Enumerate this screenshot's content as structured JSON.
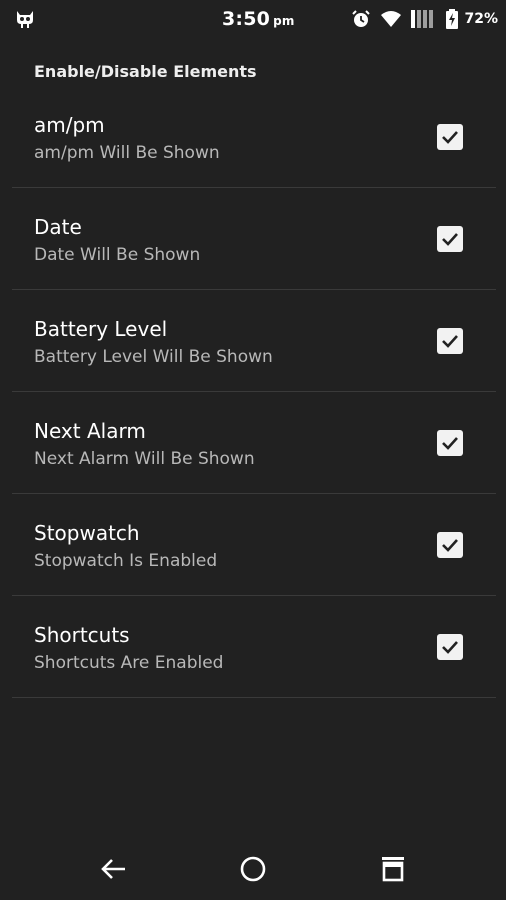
{
  "status_bar": {
    "time": "3:50",
    "ampm": "pm",
    "battery_percent": "72%",
    "icons": [
      "app-notification-icon",
      "alarm-icon",
      "wifi-icon",
      "signal-icon",
      "battery-icon"
    ]
  },
  "header": {
    "title": "Enable/Disable Elements"
  },
  "settings": [
    {
      "title": "am/pm",
      "summary": "am/pm Will Be Shown",
      "checked": true
    },
    {
      "title": "Date",
      "summary": "Date Will Be Shown",
      "checked": true
    },
    {
      "title": "Battery Level",
      "summary": "Battery Level Will Be Shown",
      "checked": true
    },
    {
      "title": "Next Alarm",
      "summary": "Next Alarm Will Be Shown",
      "checked": true
    },
    {
      "title": "Stopwatch",
      "summary": "Stopwatch Is Enabled",
      "checked": true
    },
    {
      "title": "Shortcuts",
      "summary": "Shortcuts Are Enabled",
      "checked": true
    }
  ],
  "nav": {
    "icons": [
      "back-icon",
      "home-icon",
      "recents-icon"
    ]
  },
  "colors": {
    "background": "#212121",
    "divider": "#3a3a3a",
    "summary_text": "#b8b8b8",
    "checkbox": "#f2f2f2"
  }
}
